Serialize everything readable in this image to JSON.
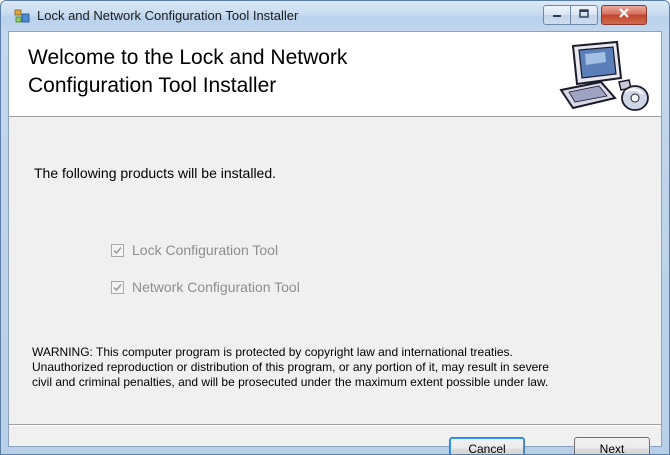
{
  "window": {
    "title": "Lock and Network Configuration Tool Installer",
    "icons": {
      "app": "installer-icon",
      "minimize": "minimize-icon",
      "maximize": "maximize-icon",
      "close": "close-icon"
    }
  },
  "banner": {
    "title_line1": "Welcome to the Lock and Network",
    "title_line2": "Configuration Tool Installer",
    "art_icon": "computer-cd-icon"
  },
  "main": {
    "intro": "The following products will be installed.",
    "products": [
      {
        "label": "Lock Configuration Tool",
        "checked": true,
        "enabled": false
      },
      {
        "label": "Network Configuration Tool",
        "checked": true,
        "enabled": false
      }
    ],
    "warning_line1": "WARNING: This computer program is protected by copyright law and international treaties.",
    "warning_line2": "Unauthorized reproduction or distribution of this program, or any portion of it, may result in severe",
    "warning_line3": "civil and criminal penalties, and will be prosecuted under the maximum extent possible under law."
  },
  "footer": {
    "cancel_label": "Cancel",
    "next_label": "Next"
  },
  "colors": {
    "title_bar": "#c7dbf1",
    "close_button": "#c2452c",
    "client_bg": "#f0f0f0",
    "disabled_text": "#8e8e8e"
  }
}
